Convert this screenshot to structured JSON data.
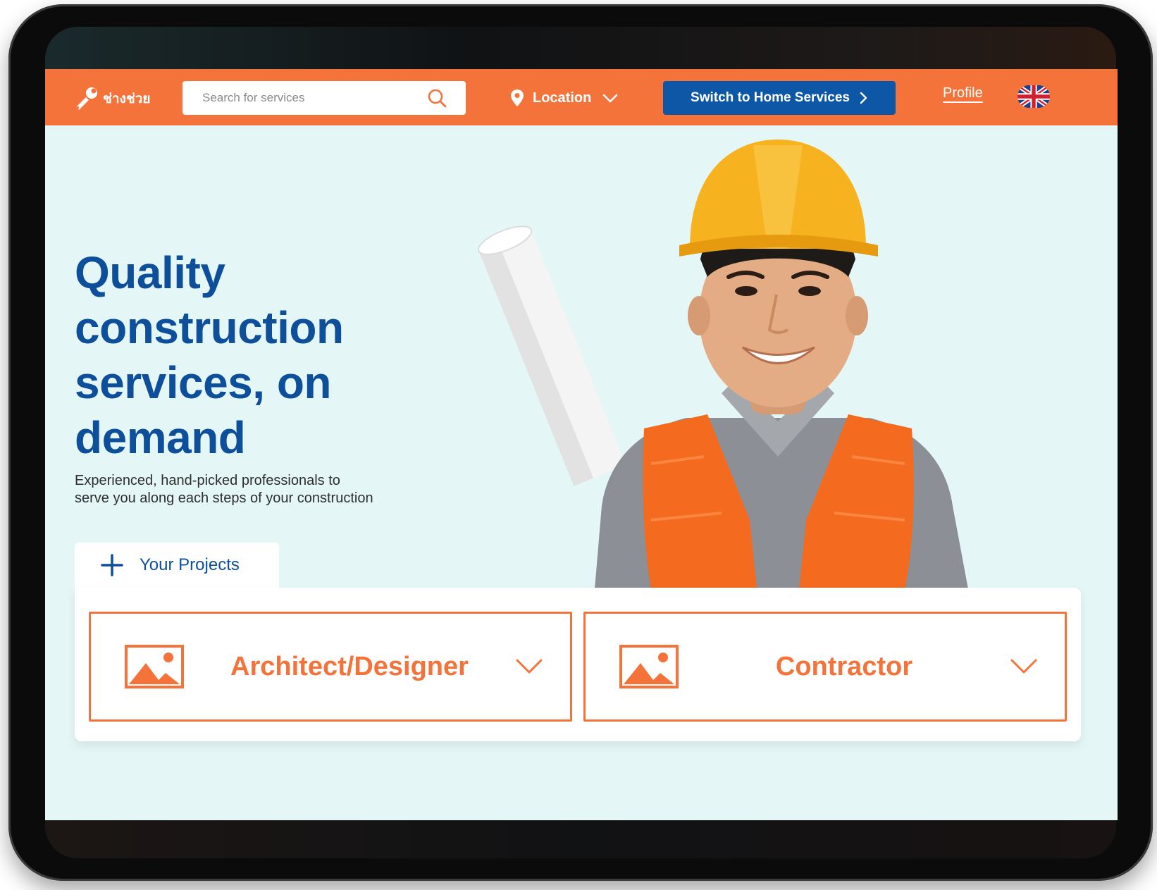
{
  "header": {
    "logo_text": "ช่างช่วย",
    "search_placeholder": "Search for services",
    "location_label": "Location",
    "switch_button_label": "Switch to Home Services",
    "profile_label": "Profile",
    "language_flag": "uk-flag-icon"
  },
  "hero": {
    "title_lines": [
      "Quality",
      "construction",
      "services, on",
      "demand"
    ],
    "subtitle": "Experienced, hand-picked professionals to serve you along each steps of your construction",
    "projects_tab_label": "Your Projects"
  },
  "panel": {
    "cards": [
      {
        "label": "Architect/Designer",
        "icon": "image-placeholder-icon"
      },
      {
        "label": "Contractor",
        "icon": "image-placeholder-icon"
      }
    ]
  },
  "colors": {
    "brand_orange": "#f4733b",
    "brand_blue": "#0d4f9a",
    "button_blue": "#0d57a6",
    "hero_background": "#e4f6f6"
  }
}
